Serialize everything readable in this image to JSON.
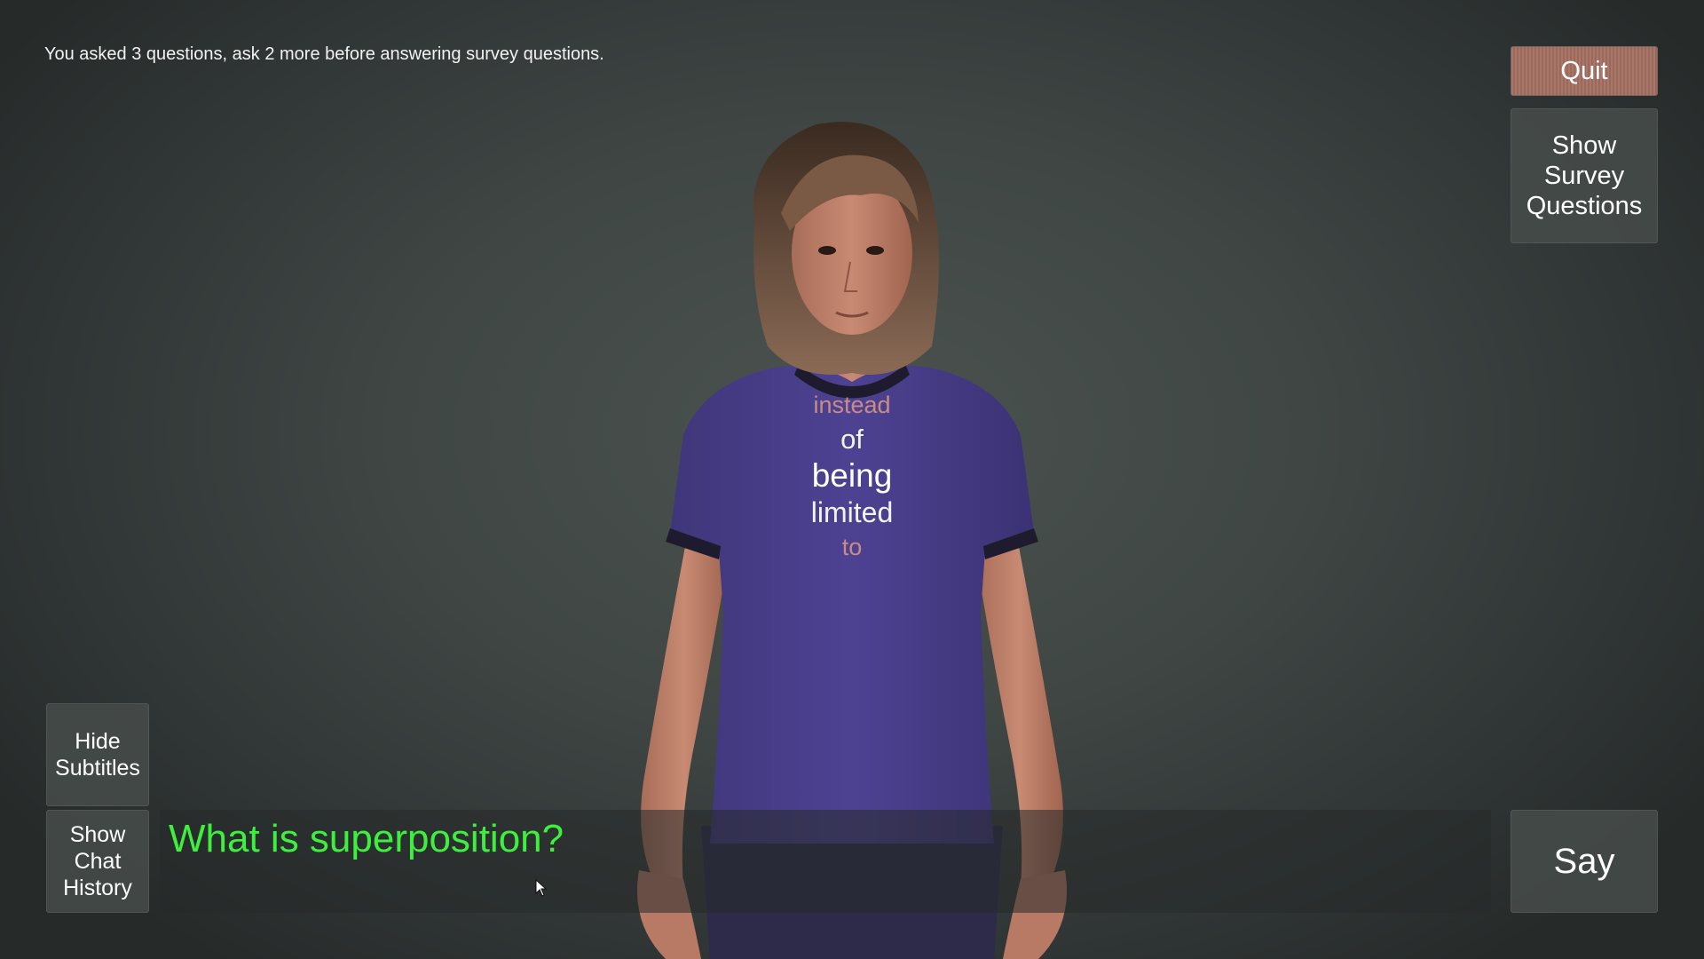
{
  "status": {
    "text": "You asked 3 questions, ask 2 more before answering survey questions."
  },
  "buttons": {
    "quit": "Quit",
    "survey_line1": "Show",
    "survey_line2": "Survey",
    "survey_line3": "Questions",
    "hide_subtitles_line1": "Hide",
    "hide_subtitles_line2": "Subtitles",
    "history_line1": "Show",
    "history_line2": "Chat",
    "history_line3": "History",
    "say": "Say"
  },
  "input": {
    "value": "What is superposition?",
    "color": "#3ef03e"
  },
  "subtitles": {
    "words": [
      "instead",
      "of",
      "being",
      "limited",
      "to"
    ]
  },
  "colors": {
    "quit_button": "#a8776a",
    "shirt": "#4a3f8c",
    "input_text": "#3ef03e"
  },
  "icons": {
    "cursor": "mouse-pointer-icon"
  }
}
